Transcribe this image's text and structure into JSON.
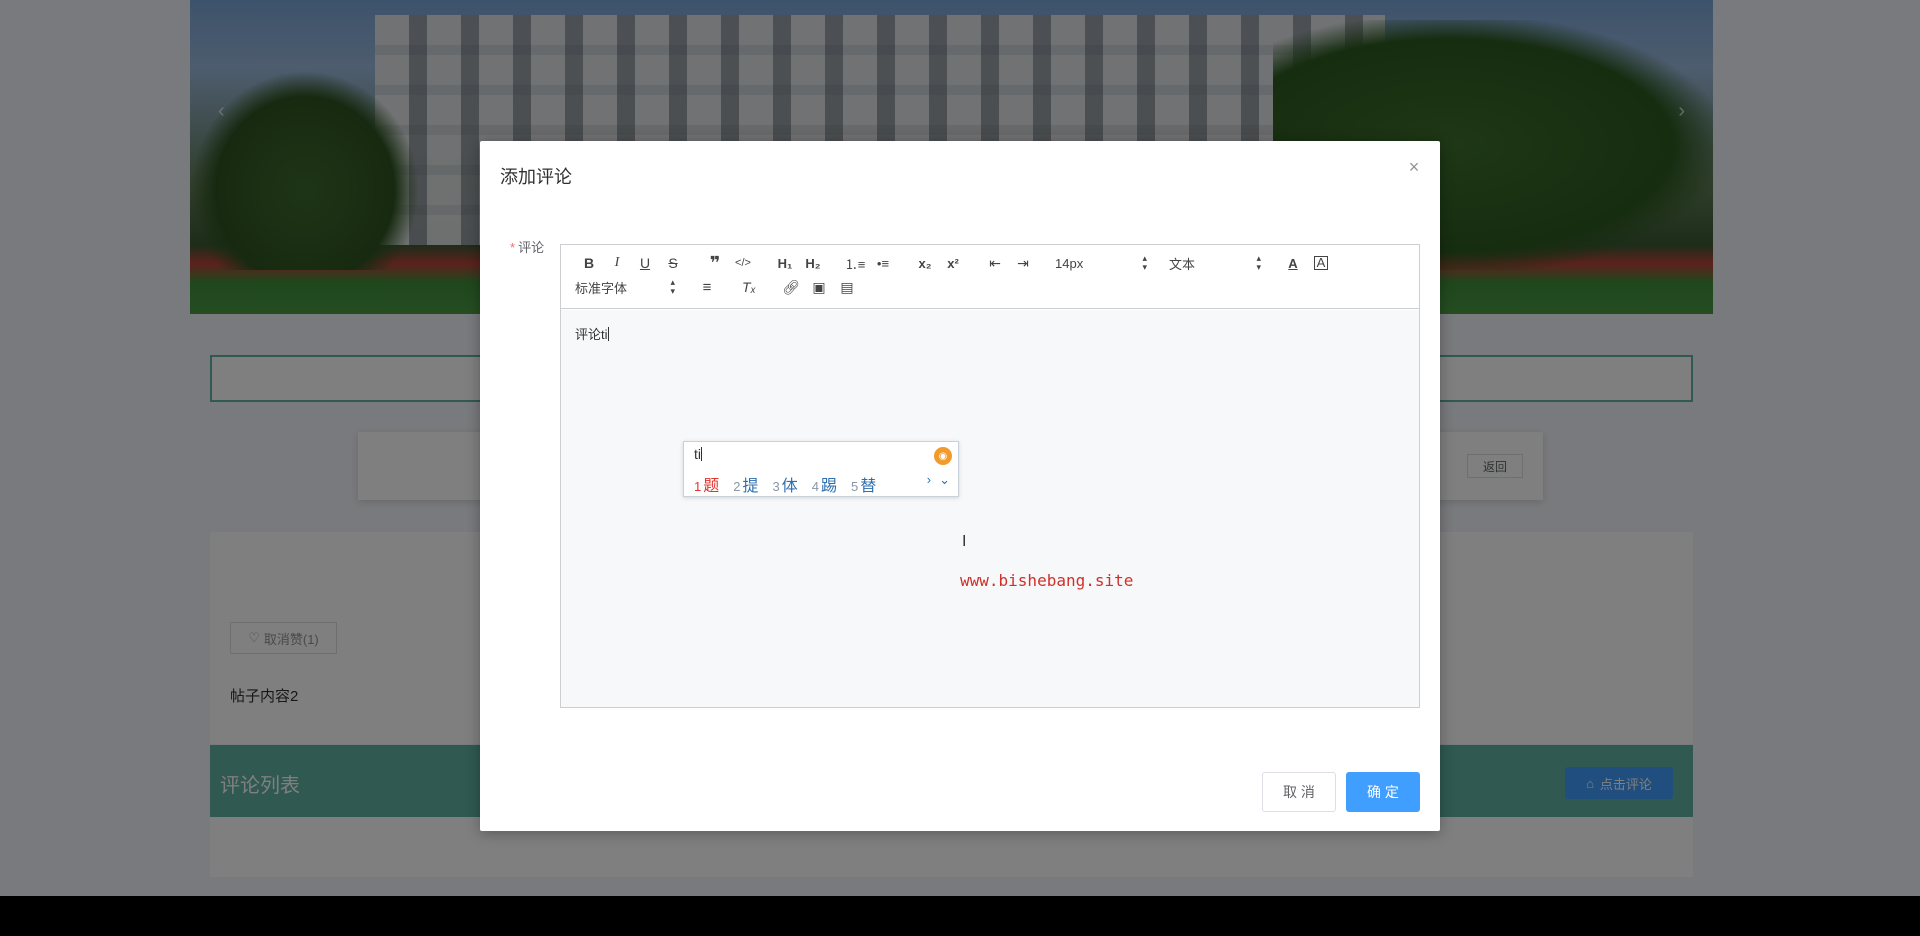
{
  "background": {
    "back_label": "返回",
    "like_label": "取消赞(1)",
    "post_content": "帖子内容2",
    "comment_list_title": "评论列表",
    "click_comment_label": "点击评论",
    "accent_color": "#5fb3a3"
  },
  "dialog": {
    "title": "添加评论",
    "field_label": "评论",
    "editor": {
      "font_size": "14px",
      "header_select": "文本",
      "font_family": "标准字体",
      "content": "评论ti"
    },
    "ime": {
      "input": "ti",
      "candidates": [
        {
          "num": "1",
          "text": "题"
        },
        {
          "num": "2",
          "text": "提"
        },
        {
          "num": "3",
          "text": "体"
        },
        {
          "num": "4",
          "text": "踢"
        },
        {
          "num": "5",
          "text": "替"
        }
      ]
    },
    "watermark": "www.bishebang.site",
    "cancel_label": "取 消",
    "confirm_label": "确 定"
  },
  "colors": {
    "primary": "#409eff",
    "required": "#f56c6c",
    "watermark": "#d0302a"
  }
}
